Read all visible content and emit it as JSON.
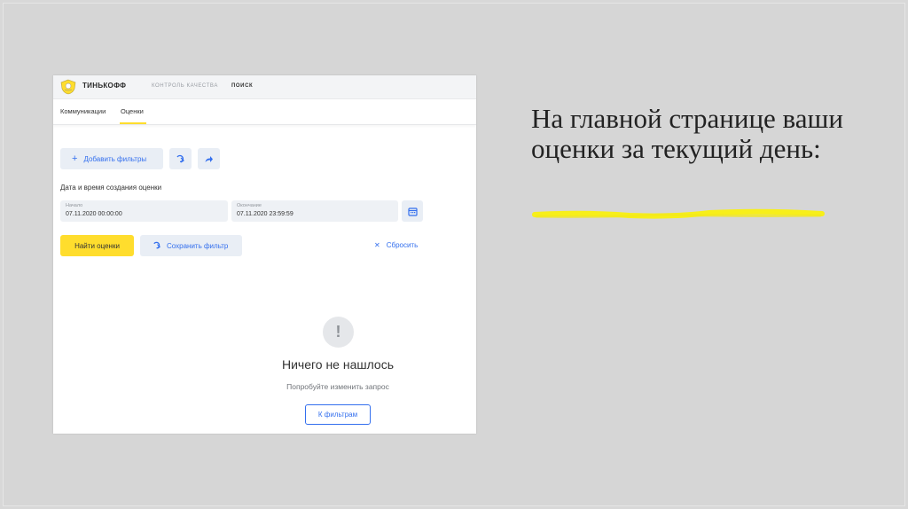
{
  "app": {
    "brand": "ТИНЬКОФФ",
    "nav": [
      "КОНТРОЛЬ КАЧЕСТВА",
      "ПОИСК"
    ],
    "active_nav": "ПОИСК",
    "tabs": [
      "Коммуникации",
      "Оценки"
    ],
    "active_tab": "Оценки"
  },
  "filters": {
    "add_label": "Добавить фильтры",
    "section_label": "Дата и время создания оценки",
    "start_caption": "Начало",
    "start_value": "07.11.2020 00:00:00",
    "end_caption": "Окончание",
    "end_value": "07.11.2020 23:59:59",
    "find_label": "Найти оценки",
    "save_label": "Сохранить фильтр",
    "reset_label": "Сбросить"
  },
  "empty_state": {
    "icon": "!",
    "title": "Ничего не нашлось",
    "subtitle": "Попробуйте изменить запрос",
    "button": "К фильтрам"
  },
  "slide": {
    "heading": "На главной странице ваши оценки за текущий день:"
  },
  "colors": {
    "accent_yellow": "#ffdd2d",
    "link_blue": "#336fee",
    "highlight_yellow": "#f7ef1a"
  }
}
